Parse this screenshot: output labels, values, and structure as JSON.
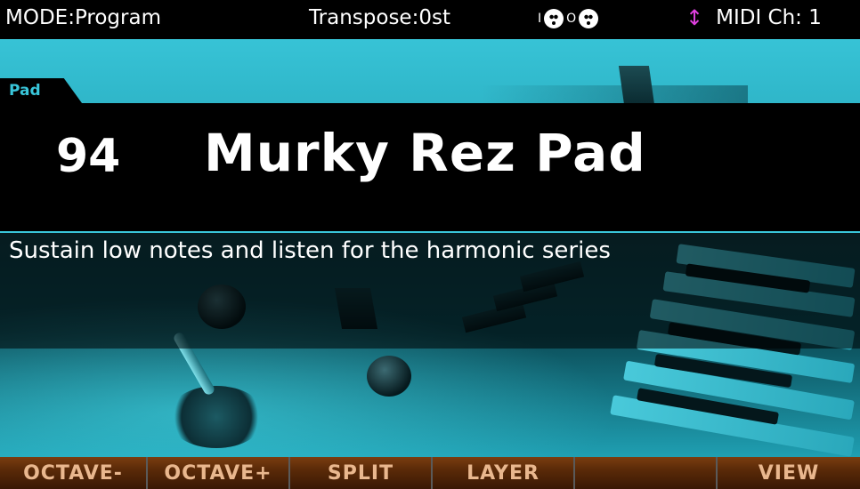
{
  "status_bar": {
    "mode": "MODE:Program",
    "transpose": "Transpose:0st",
    "midi_in_label": "I",
    "midi_out_label": "O",
    "midi_channel": "MIDI Ch: 1",
    "arrow_icon": "up-down-arrow-icon",
    "arrow_color": "#e040e0"
  },
  "category": {
    "label": "Pad",
    "accent_color": "#39c6da"
  },
  "program": {
    "number": "94",
    "name": "Murky Rez Pad",
    "description": "Sustain low notes and listen for the harmonic series"
  },
  "soft_buttons": [
    {
      "label": "OCTAVE-"
    },
    {
      "label": "OCTAVE+"
    },
    {
      "label": "SPLIT"
    },
    {
      "label": "LAYER"
    },
    {
      "label": ""
    },
    {
      "label": "VIEW"
    }
  ],
  "colors": {
    "softbutton_text": "#e9b78e",
    "softbutton_bg": "#6a320c",
    "photo_tint": "#2db8cc"
  }
}
